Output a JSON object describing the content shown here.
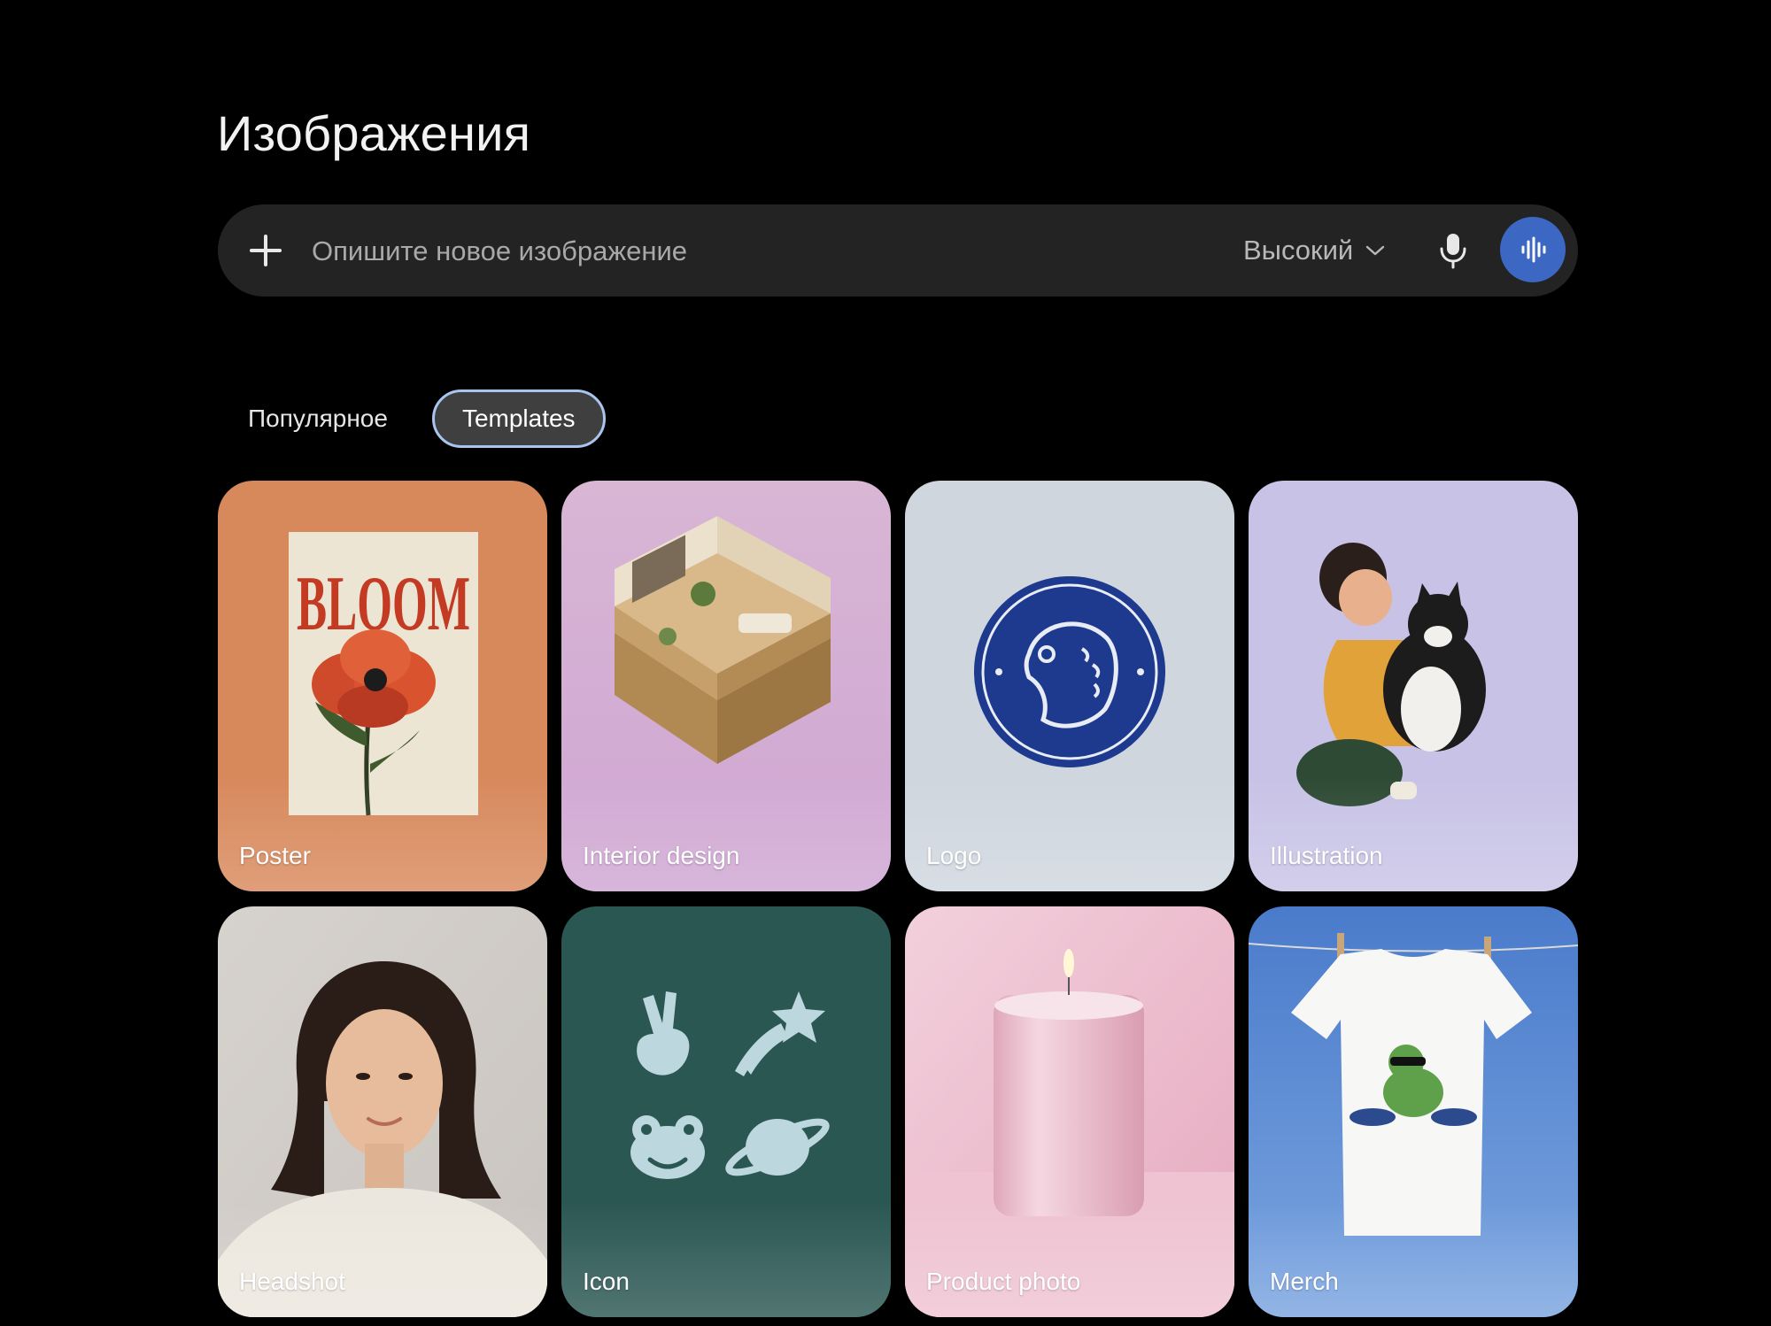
{
  "page": {
    "title": "Изображения"
  },
  "prompt": {
    "placeholder": "Опишите новое изображение",
    "quality_label": "Высокий",
    "icons": [
      "plus-icon",
      "chevron-down-icon",
      "microphone-icon",
      "voice-waveform-icon"
    ]
  },
  "tabs": [
    {
      "label": "Популярное",
      "active": false
    },
    {
      "label": "Templates",
      "active": true
    }
  ],
  "templates": [
    {
      "label": "Poster",
      "bg": "#d8895c",
      "art_text": "BLOOM"
    },
    {
      "label": "Interior design",
      "bg": "#d9b2d6"
    },
    {
      "label": "Logo",
      "bg": "#cfd6de"
    },
    {
      "label": "Illustration",
      "bg": "#c8c3e6"
    },
    {
      "label": "Headshot",
      "bg": "#d8d5d1"
    },
    {
      "label": "Icon",
      "bg": "#2b5753"
    },
    {
      "label": "Product photo",
      "bg": "#efc4d3"
    },
    {
      "label": "Merch",
      "bg": "#5585d0"
    }
  ],
  "colors": {
    "accent": "#3c68c4",
    "tab_border": "#a9c4ef",
    "bar_bg": "#232323"
  }
}
